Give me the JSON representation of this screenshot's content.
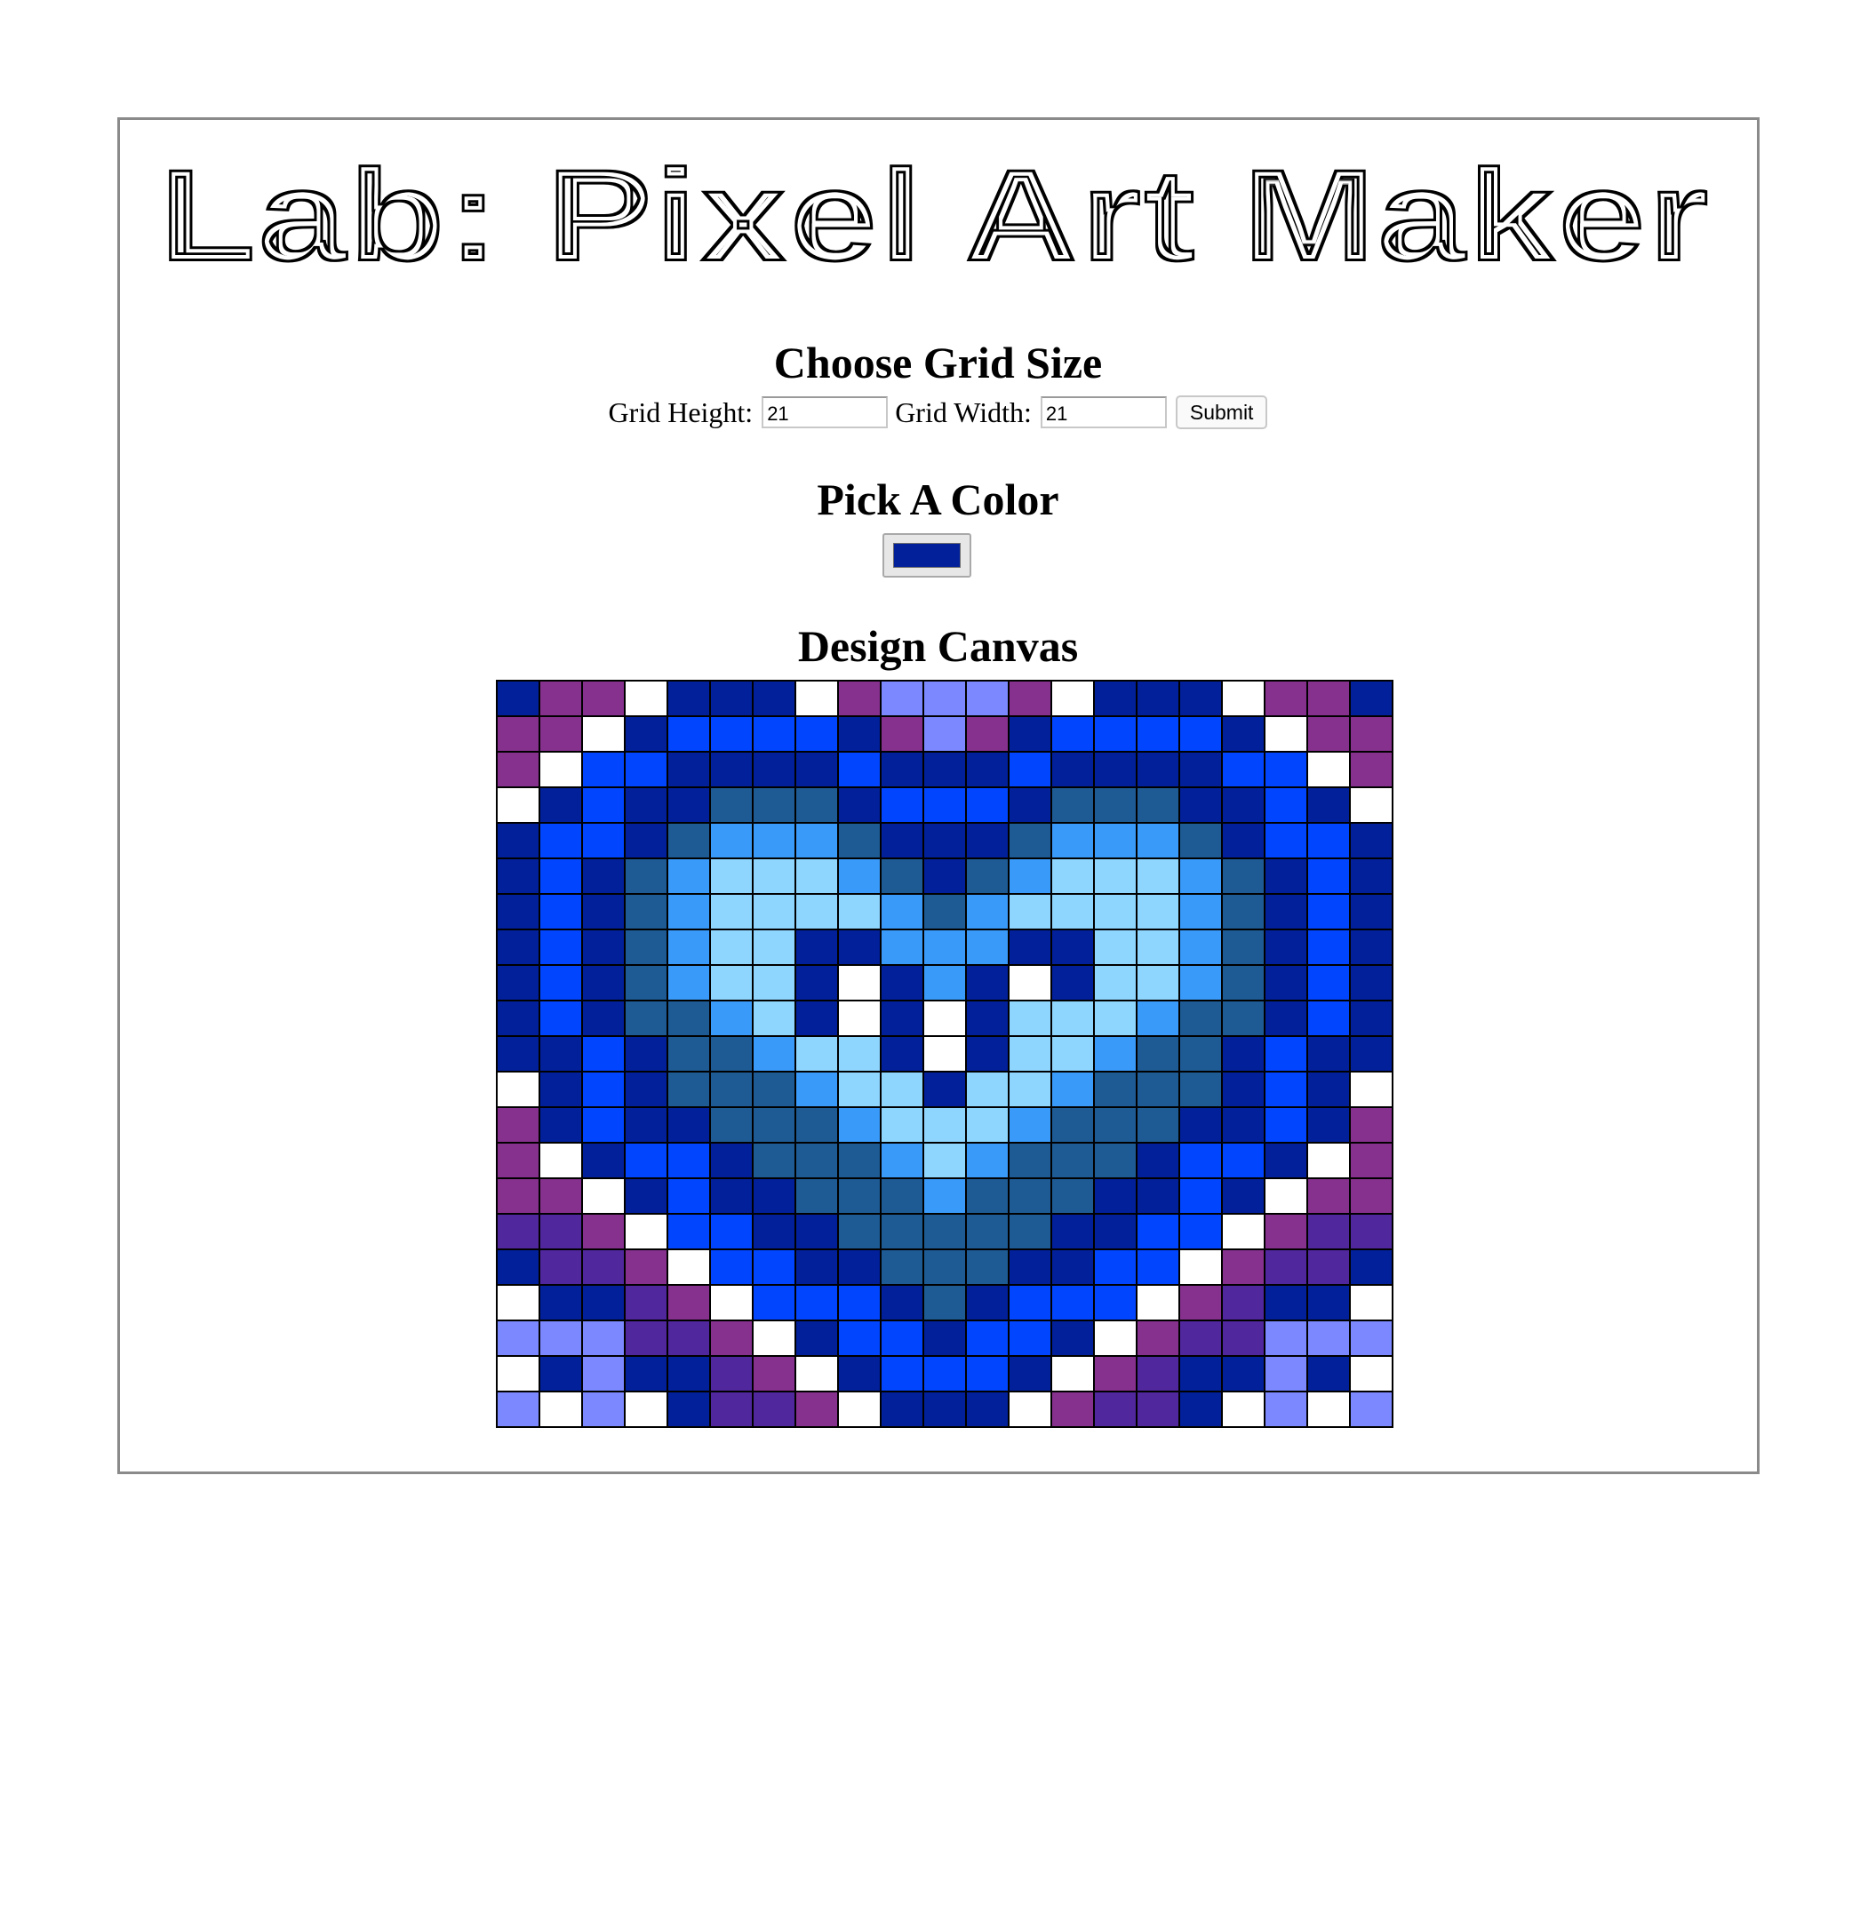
{
  "title": "Lab: Pixel Art Maker",
  "grid_size": {
    "heading": "Choose Grid Size",
    "height_label": "Grid Height:",
    "height_value": "21",
    "width_label": "Grid Width:",
    "width_value": "21",
    "submit_label": "Submit"
  },
  "color": {
    "heading": "Pick A Color",
    "selected": "#02209a"
  },
  "canvas": {
    "heading": "Design Canvas",
    "palette": {
      "W": "#ffffff",
      "N": "#02209a",
      "P": "#87318e",
      "L": "#7b88ff",
      "B": "#0145ff",
      "T": "#1e5b94",
      "S": "#3a9af9",
      "C": "#8fd6ff",
      "V": "#50279d"
    },
    "rows": [
      "NPPWNNNWPLLLPWNNNWPPN",
      "PPWNBBBBNPLPNBBBBNWPP",
      "PWBBNNNNBNNNBNNNNBBWP",
      "WNBNNTTTNBBBNTTTNNBNW",
      "NBBNTSSSTNNNTSSSTNBBN",
      "NBNTSCCCSTNTSCCCSTNBN",
      "NBNTSCCCCSTSCCCCSTNBN",
      "NBNTSCCNNSSSNNCCSTNBN",
      "NBNTSCCNWNSNWNCCSTNBN",
      "NBNTTSCNWNWNCCCSTTNBN",
      "NNBNTTSCCNWNCCSTTNBNN",
      "WNBNTTTSCCNCCSTTTNBNW",
      "PNBNNTTTSCCCSTTTNNBNP",
      "PWNBBNTTTSCSTTTNBBNWP",
      "PPWNBNNTTTSTTTNNBNWPP",
      "VVPWBBNNTTTTTNNBBWPVV",
      "NVVPWBBNNTTTNNBBWPVVN",
      "WNNVPWBBBNTNBBBWPVNNW",
      "LLLVVPWNBBNBBNWPVVLLL",
      "WNLNNVPWNBBBNWPVNNLNW",
      "LWLWNVVPWNNNWPVVNWLWL"
    ]
  }
}
